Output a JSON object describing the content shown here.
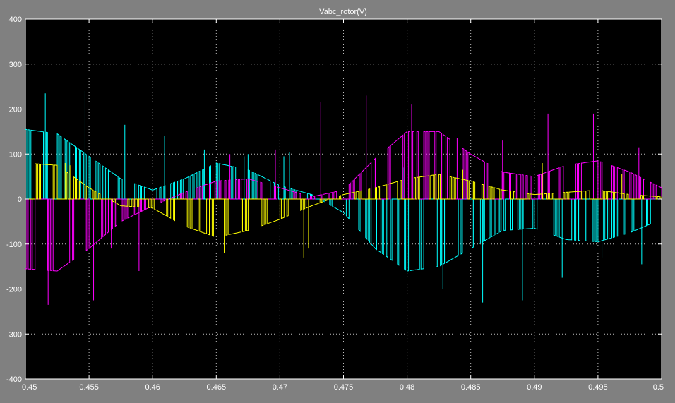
{
  "chart_data": {
    "type": "line",
    "title": "Vabc_rotor(V)",
    "xlabel": "",
    "ylabel": "",
    "xlim": [
      0.45,
      0.5
    ],
    "ylim": [
      -400,
      400
    ],
    "xticks": [
      0.45,
      0.455,
      0.46,
      0.465,
      0.47,
      0.475,
      0.48,
      0.485,
      0.49,
      0.495,
      0.5
    ],
    "xtick_labels": [
      "0.45",
      "0.455",
      "0.46",
      "0.465",
      "0.47",
      "0.475",
      "0.48",
      "0.485",
      "0.49",
      "0.495",
      "0.5"
    ],
    "yticks": [
      400,
      300,
      200,
      100,
      0,
      -100,
      -200,
      -300,
      -400
    ],
    "ytick_labels": [
      "400",
      "300",
      "200",
      "100",
      "0",
      "-100",
      "-200",
      "-300",
      "-400"
    ],
    "grid": true,
    "legend": false,
    "background": "#000000",
    "frame_color": "#808080",
    "series": [
      {
        "color": "#00ffff",
        "envelope": {
          "x": [
            0.45,
            0.4525,
            0.455,
            0.4575,
            0.46,
            0.4625,
            0.465,
            0.4675,
            0.47,
            0.4725,
            0.475,
            0.4775,
            0.48,
            0.4825,
            0.485,
            0.4875,
            0.49,
            0.4925,
            0.495,
            0.4975,
            0.5
          ],
          "y": [
            155,
            145,
            95,
            45,
            20,
            45,
            80,
            65,
            30,
            10,
            -30,
            -110,
            -160,
            -150,
            -110,
            -70,
            -65,
            -90,
            -95,
            -75,
            -45
          ]
        },
        "peaks": [
          235,
          240,
          165,
          140,
          110,
          95,
          95,
          100,
          105,
          70,
          -200,
          -230,
          -225,
          -175,
          -130,
          -145
        ]
      },
      {
        "color": "#ff00ff",
        "envelope": {
          "x": [
            0.45,
            0.4525,
            0.455,
            0.4575,
            0.46,
            0.4625,
            0.465,
            0.4675,
            0.47,
            0.4725,
            0.475,
            0.4775,
            0.48,
            0.4825,
            0.485,
            0.4875,
            0.49,
            0.4925,
            0.495,
            0.4975,
            0.5
          ],
          "y": [
            -155,
            -160,
            -110,
            -50,
            -15,
            15,
            40,
            45,
            25,
            5,
            20,
            90,
            150,
            150,
            100,
            60,
            50,
            75,
            85,
            60,
            25
          ]
        },
        "peaks": [
          -235,
          -225,
          -160,
          -110,
          100,
          110,
          215,
          230,
          210,
          135,
          130,
          190,
          190,
          115
        ]
      },
      {
        "color": "#ffff00",
        "envelope": {
          "x": [
            0.45,
            0.4525,
            0.455,
            0.4575,
            0.46,
            0.4625,
            0.465,
            0.4675,
            0.47,
            0.4725,
            0.475,
            0.4775,
            0.48,
            0.4825,
            0.485,
            0.4875,
            0.49,
            0.4925,
            0.495,
            0.4975,
            0.5
          ],
          "y": [
            80,
            75,
            25,
            -15,
            -20,
            -60,
            -85,
            -70,
            -45,
            -15,
            10,
            25,
            45,
            55,
            40,
            20,
            10,
            15,
            20,
            10,
            5
          ]
        },
        "peaks": [
          80,
          75,
          -120,
          -130,
          -110,
          65,
          80,
          55
        ]
      }
    ]
  }
}
